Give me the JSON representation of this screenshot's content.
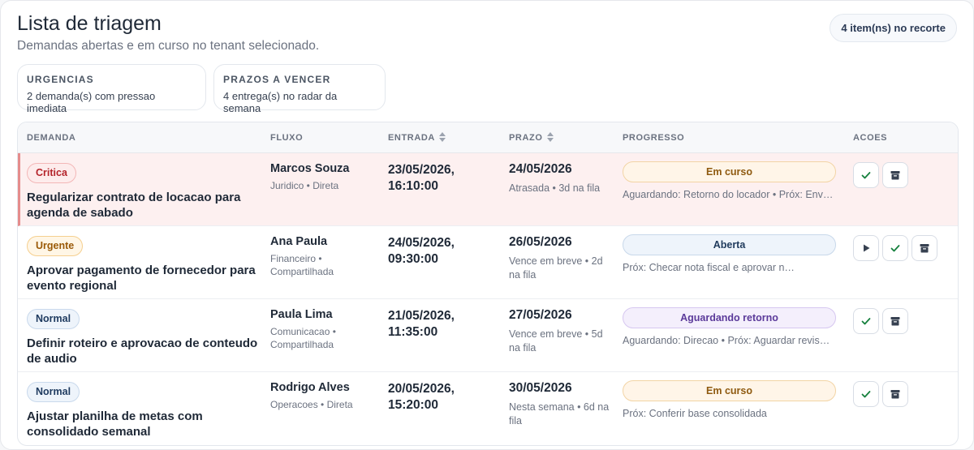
{
  "header": {
    "title": "Lista de triagem",
    "subtitle": "Demandas abertas e em curso no tenant selecionado.",
    "count_label": "4 item(ns) no recorte"
  },
  "stats": [
    {
      "label": "URGENCIAS",
      "value": "2 demanda(s) com pressao imediata"
    },
    {
      "label": "PRAZOS A VENCER",
      "value": "4 entrega(s) no radar da semana"
    }
  ],
  "table": {
    "columns": {
      "demanda": "DEMANDA",
      "fluxo": "FLUXO",
      "entrada": "ENTRADA",
      "prazo": "PRAZO",
      "progresso": "PROGRESSO",
      "acoes": "ACOES"
    },
    "rows": [
      {
        "priority": "Critica",
        "title": "Regularizar contrato de locacao para agenda de sabado",
        "person": "Marcos Souza",
        "flow": "Juridico • Direta",
        "entry": "23/05/2026, 16:10:00",
        "deadline": "24/05/2026",
        "deadline_meta": "Atrasada • 3d na fila",
        "status": "Em curso",
        "progress_note": "Aguardando: Retorno do locador • Próx: Enviar documentação"
      },
      {
        "priority": "Urgente",
        "title": "Aprovar pagamento de fornecedor para evento regional",
        "person": "Ana Paula",
        "flow": "Financeiro • Compartilhada",
        "entry": "24/05/2026, 09:30:00",
        "deadline": "26/05/2026",
        "deadline_meta": "Vence em breve • 2d na fila",
        "status": "Aberta",
        "progress_note": "Próx: Checar nota fiscal e aprovar no sistema"
      },
      {
        "priority": "Normal",
        "title": "Definir roteiro e aprovacao de conteudo de audio",
        "person": "Paula Lima",
        "flow": "Comunicacao • Compartilhada",
        "entry": "21/05/2026, 11:35:00",
        "deadline": "27/05/2026",
        "deadline_meta": "Vence em breve • 5d na fila",
        "status": "Aguardando retorno",
        "progress_note": "Aguardando: Direcao • Próx: Aguardar revisao final"
      },
      {
        "priority": "Normal",
        "title": "Ajustar planilha de metas com consolidado semanal",
        "person": "Rodrigo Alves",
        "flow": "Operacoes • Direta",
        "entry": "20/05/2026, 15:20:00",
        "deadline": "30/05/2026",
        "deadline_meta": "Nesta semana • 6d na fila",
        "status": "Em curso",
        "progress_note": "Próx: Conferir base consolidada"
      }
    ]
  },
  "colors": {
    "critical_bg": "#fdf0f0",
    "critical_accent": "#e58c8c",
    "check_icon": "#15803d",
    "icon_dark": "#374151"
  },
  "icons": [
    "check-icon",
    "archive-icon",
    "play-icon",
    "sort-icon"
  ]
}
